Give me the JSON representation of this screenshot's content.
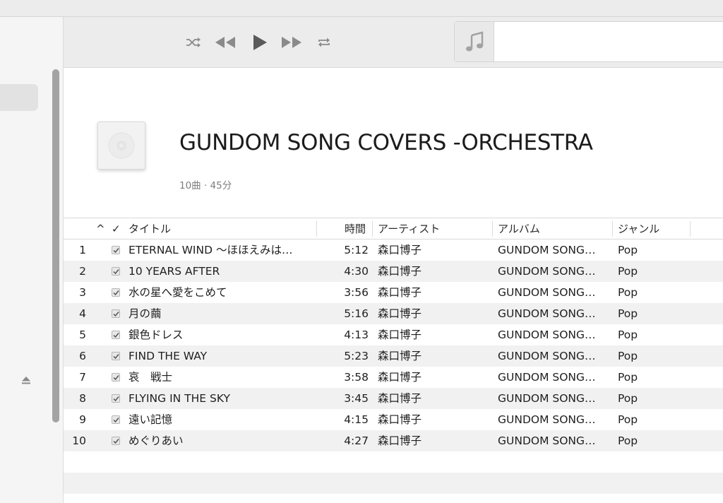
{
  "toolbar": {
    "icons": [
      "shuffle-icon",
      "previous-icon",
      "play-icon",
      "next-icon",
      "repeat-icon",
      "music-note-icon"
    ]
  },
  "album": {
    "title": "GUNDOM SONG COVERS -ORCHESTRA",
    "meta": "10曲 · 45分"
  },
  "table": {
    "headers": {
      "sort": "^",
      "check": "✓",
      "title": "タイトル",
      "time": "時間",
      "artist": "アーティスト",
      "album": "アルバム",
      "genre": "ジャンル"
    },
    "rows": [
      {
        "num": "1",
        "title": "ETERNAL WIND 〜ほほえみは…",
        "time": "5:12",
        "artist": "森口博子",
        "album": "GUNDOM SONG…",
        "genre": "Pop",
        "checked": true
      },
      {
        "num": "2",
        "title": "10 YEARS AFTER",
        "time": "4:30",
        "artist": "森口博子",
        "album": "GUNDOM SONG…",
        "genre": "Pop",
        "checked": true
      },
      {
        "num": "3",
        "title": "水の星へ愛をこめて",
        "time": "3:56",
        "artist": "森口博子",
        "album": "GUNDOM SONG…",
        "genre": "Pop",
        "checked": true
      },
      {
        "num": "4",
        "title": "月の繭",
        "time": "5:16",
        "artist": "森口博子",
        "album": "GUNDOM SONG…",
        "genre": "Pop",
        "checked": true
      },
      {
        "num": "5",
        "title": "銀色ドレス",
        "time": "4:13",
        "artist": "森口博子",
        "album": "GUNDOM SONG…",
        "genre": "Pop",
        "checked": true
      },
      {
        "num": "6",
        "title": "FIND THE WAY",
        "time": "5:23",
        "artist": "森口博子",
        "album": "GUNDOM SONG…",
        "genre": "Pop",
        "checked": true
      },
      {
        "num": "7",
        "title": "哀　戦士",
        "time": "3:58",
        "artist": "森口博子",
        "album": "GUNDOM SONG…",
        "genre": "Pop",
        "checked": true
      },
      {
        "num": "8",
        "title": "FLYING IN THE SKY",
        "time": "3:45",
        "artist": "森口博子",
        "album": "GUNDOM SONG…",
        "genre": "Pop",
        "checked": true
      },
      {
        "num": "9",
        "title": "遠い記憶",
        "time": "4:15",
        "artist": "森口博子",
        "album": "GUNDOM SONG…",
        "genre": "Pop",
        "checked": true
      },
      {
        "num": "10",
        "title": "めぐりあい",
        "time": "4:27",
        "artist": "森口博子",
        "album": "GUNDOM SONG…",
        "genre": "Pop",
        "checked": true
      }
    ]
  },
  "colors": {
    "toolbar_bg": "#ececec",
    "sidebar_bg": "#f5f5f5",
    "row_alt": "#f1f1f1",
    "icon_gray": "#8a8a8a"
  }
}
